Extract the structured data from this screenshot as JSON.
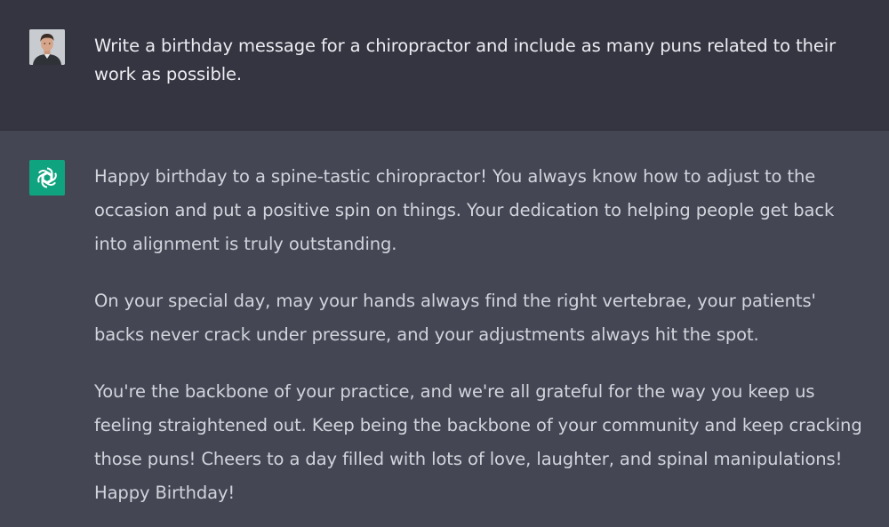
{
  "conversation": {
    "user_message": "Write a birthday message for a chiropractor and include as many puns related to their work as possible.",
    "assistant_paragraphs": [
      "Happy birthday to a spine-tastic chiropractor! You always know how to adjust to the occasion and put a positive spin on things. Your dedication to helping people get back into alignment is truly outstanding.",
      "On your special day, may your hands always find the right vertebrae, your patients' backs never crack under pressure, and your adjustments always hit the spot.",
      "You're the backbone of your practice, and we're all grateful for the way you keep us feeling straightened out. Keep being the backbone of your community and keep cracking those puns! Cheers to a day filled with lots of love, laughter, and spinal manipulations! Happy Birthday!"
    ]
  },
  "icons": {
    "user_avatar": "user-avatar",
    "assistant_avatar": "openai-logo-icon"
  },
  "colors": {
    "user_row_bg": "#343541",
    "assistant_row_bg": "#444654",
    "assistant_avatar_bg": "#10a37f",
    "text": "#d1d5db"
  }
}
